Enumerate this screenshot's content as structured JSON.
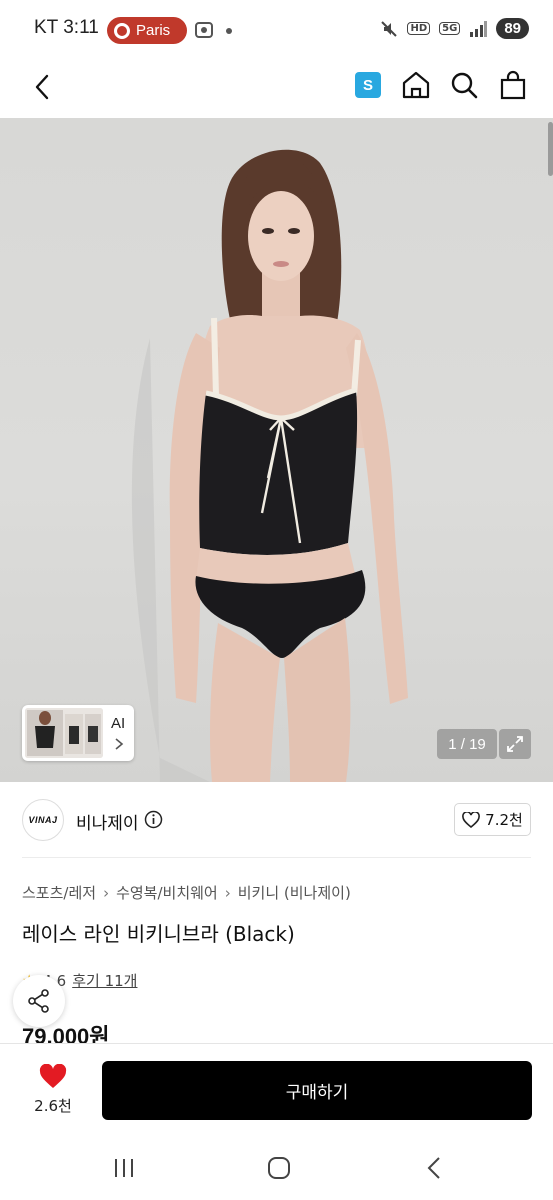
{
  "status_bar": {
    "carrier": "KT",
    "time": "3:11",
    "location_pill": "Paris",
    "hd_label": "HD",
    "network_label": "5G",
    "battery": "89",
    "pill_color": "#c0392b"
  },
  "header": {
    "badge_label": "S",
    "badge_color": "#29a8e0",
    "icons": [
      "back-chevron-icon",
      "home-icon",
      "search-icon",
      "cart-bag-icon"
    ]
  },
  "gallery": {
    "ai_label": "AI",
    "page_counter": "1 / 19"
  },
  "brand": {
    "logo_text": "VINAJ",
    "name": "비나제이",
    "like_count": "7.2천"
  },
  "product": {
    "breadcrumb": [
      "스포츠/레저",
      "수영복/비치웨어",
      "비키니 (비나제이)"
    ],
    "title": "레이스 라인 비키니브라 (Black)",
    "rating": "4.6",
    "review_link": "후기 11개",
    "price": "79,000원"
  },
  "action_bar": {
    "wish_count": "2.6천",
    "buy_label": "구매하기",
    "heart_color": "#e31b23"
  },
  "nav_bar": {
    "icons": [
      "recent-apps-icon",
      "home-nav-icon",
      "back-nav-icon"
    ]
  }
}
